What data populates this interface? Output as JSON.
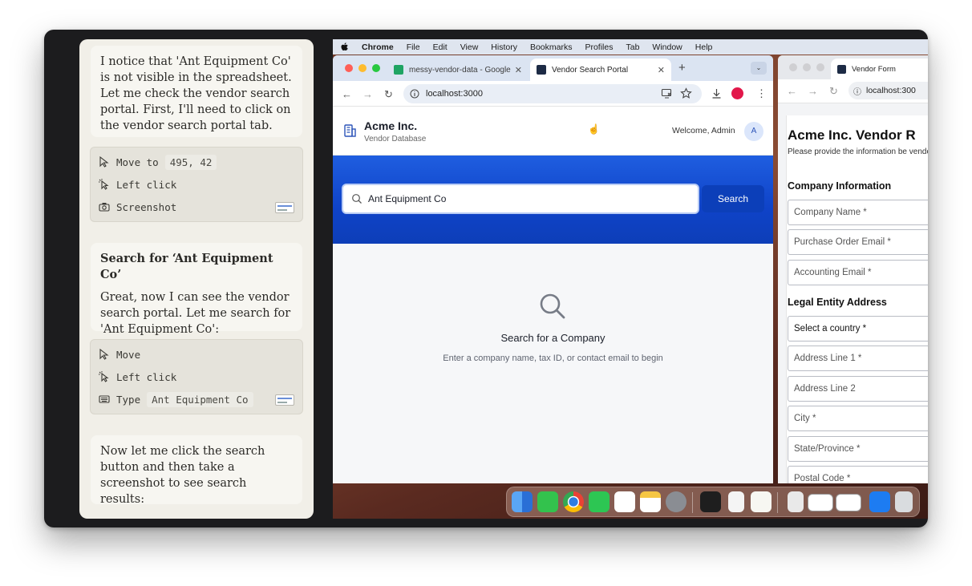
{
  "chat": {
    "msg1": "I notice that 'Ant Equipment Co' is not visible in the spreadsheet. Let me check the vendor search portal. First, I'll need to click on the vendor search portal tab.",
    "actions1": [
      {
        "label": "Move to",
        "value": "495, 42",
        "icon": "cursor-icon"
      },
      {
        "label": "Left click",
        "icon": "click-icon"
      },
      {
        "label": "Screenshot",
        "icon": "camera-icon"
      }
    ],
    "msg2_title": "Search for ‘Ant Equipment Co’",
    "msg2": "Great, now I can see the vendor search portal. Let me search for 'Ant Equipment Co':",
    "actions2": [
      {
        "label": "Move",
        "icon": "cursor-icon"
      },
      {
        "label": "Left click",
        "icon": "click-icon"
      },
      {
        "label": "Type",
        "value": "Ant Equipment Co",
        "icon": "keyboard-icon"
      }
    ],
    "msg3": "Now let me click the search button and then take a screenshot to see search results:"
  },
  "menubar": {
    "app": "Chrome",
    "items": [
      "File",
      "Edit",
      "View",
      "History",
      "Bookmarks",
      "Profiles",
      "Tab",
      "Window",
      "Help"
    ]
  },
  "browser": {
    "tabs": [
      {
        "title": "messy-vendor-data - Google",
        "favicon_color": "#1fa463"
      },
      {
        "title": "Vendor Search Portal",
        "favicon_color": "#1d2b45"
      }
    ],
    "url": "localhost:3000"
  },
  "site": {
    "brand": "Acme Inc.",
    "sub": "Vendor Database",
    "welcome": "Welcome, Admin",
    "avatar": "A",
    "search_value": "Ant Equipment Co",
    "search_button": "Search",
    "empty_title": "Search for a Company",
    "empty_sub": "Enter a company name, tax ID, or contact email to begin"
  },
  "form_window": {
    "tab": "Vendor Form",
    "url": "localhost:300",
    "title": "Acme Inc. Vendor R",
    "desc": "Please provide the information be vendor.",
    "section1": "Company Information",
    "fields1": [
      "Company Name *",
      "Purchase Order Email *",
      "Accounting Email *"
    ],
    "section2": "Legal Entity Address",
    "fields2": [
      "Select a country *",
      "Address Line 1 *",
      "Address Line 2",
      "City *",
      "State/Province *",
      "Postal Code *"
    ]
  },
  "colors": {
    "accent": "#0c3fb9",
    "hero": "#1f5ee0",
    "chat_bg": "#f1efe8"
  }
}
